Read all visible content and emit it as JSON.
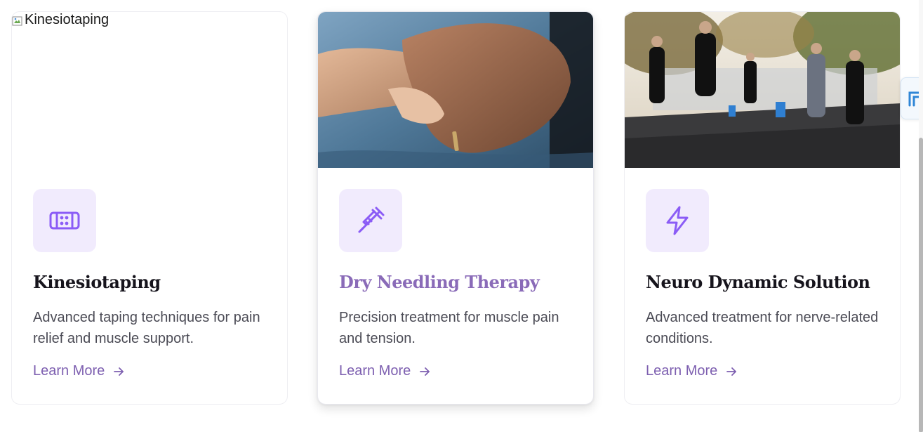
{
  "cards": [
    {
      "image_alt": "Kinesiotaping",
      "icon": "bandage-icon",
      "title": "Kinesiotaping",
      "description": "Advanced taping techniques for pain relief and muscle support.",
      "link_label": "Learn More"
    },
    {
      "image_alt": "Dry Needling Therapy",
      "icon": "syringe-icon",
      "title": "Dry Needling Therapy",
      "description": "Precision treatment for muscle pain and tension.",
      "link_label": "Learn More"
    },
    {
      "image_alt": "Neuro Dynamic Solution",
      "icon": "lightning-bolt-icon",
      "title": "Neuro Dynamic Solution",
      "description": "Advanced treatment for nerve-related conditions.",
      "link_label": "Learn More"
    }
  ],
  "colors": {
    "accent": "#7d5fb0",
    "icon_purple": "#8b5cf6",
    "icon_bg": "#f1ebfd",
    "title_dark": "#16141c",
    "title_hover": "#8a6bb8",
    "body_text": "#4b4b55"
  }
}
